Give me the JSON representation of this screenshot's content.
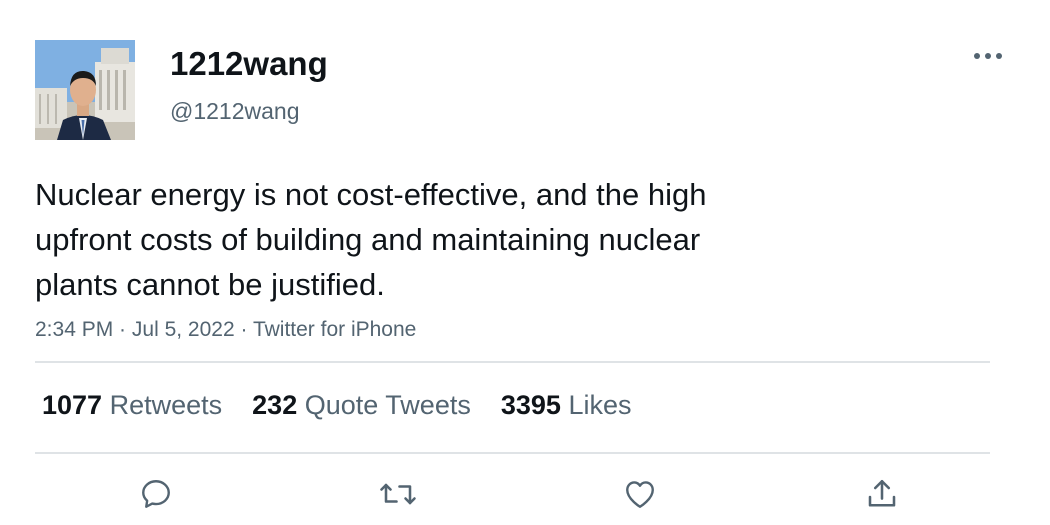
{
  "user": {
    "display_name": "1212wang",
    "handle": "@1212wang"
  },
  "tweet": {
    "text_lines": [
      "Nuclear energy is not cost-effective, and the high",
      "upfront costs of building and maintaining nuclear",
      "plants cannot be justified."
    ],
    "time": "2:34 PM",
    "separator": " · ",
    "date": "Jul 5, 2022",
    "source": "Twitter for iPhone"
  },
  "stats": {
    "retweets": {
      "count": "1077",
      "label": "Retweets"
    },
    "quotes": {
      "count": "232",
      "label": "Quote Tweets"
    },
    "likes": {
      "count": "3395",
      "label": "Likes"
    }
  },
  "icons": {
    "more": "more-horizontal-icon",
    "reply": "reply-icon",
    "retweet": "retweet-icon",
    "like": "heart-icon",
    "share": "share-icon"
  },
  "colors": {
    "text": "#0f1419",
    "secondary": "#536471",
    "divider": "#dfe3e6"
  }
}
